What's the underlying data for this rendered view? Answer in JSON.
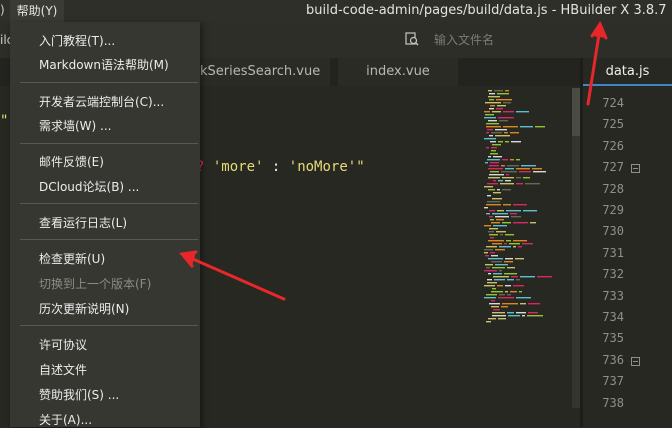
{
  "window": {
    "title": "build-code-admin/pages/build/data.js - HBuilder X 3.8.7",
    "menu_prev_partial": ")",
    "menu_help": "帮助(Y)"
  },
  "search": {
    "placeholder": "输入文件名",
    "left_partial": "ilc"
  },
  "tabs": [
    {
      "label": "kSeriesSearch.vue"
    },
    {
      "label": "index.vue"
    },
    {
      "label": "data.js",
      "active": true
    }
  ],
  "editor": {
    "line1_partial": "\"",
    "line2_op": "?",
    "line2_str1": "'more'",
    "line2_colon": ":",
    "line2_str2": "'noMore'\""
  },
  "gutter": {
    "line_numbers": [
      "724",
      "725",
      "726",
      "727",
      "728",
      "729",
      "730",
      "731",
      "732",
      "733",
      "734",
      "735",
      "736",
      "737",
      "738"
    ],
    "fold_markers": [
      "727",
      "736"
    ]
  },
  "help_menu": {
    "items": [
      {
        "label": "入门教程(T)..."
      },
      {
        "label": "Markdown语法帮助(M)"
      },
      {
        "label": "开发者云端控制台(C)..."
      },
      {
        "label": "需求墙(W) ..."
      },
      {
        "label": "邮件反馈(E)"
      },
      {
        "label": "DCloud论坛(B) ..."
      },
      {
        "label": "查看运行日志(L)"
      },
      {
        "label": "检查更新(U)"
      },
      {
        "label": "切换到上一个版本(F)",
        "disabled": true
      },
      {
        "label": "历次更新说明(N)"
      },
      {
        "label": "许可协议"
      },
      {
        "label": "自述文件"
      },
      {
        "label": "赞助我们(S) ..."
      },
      {
        "label": "关于(A)..."
      }
    ]
  },
  "colors": {
    "annotation": "#e8272a",
    "accent_tab": "#3f85c9",
    "string": "#e6db74",
    "keyword": "#f92672"
  }
}
